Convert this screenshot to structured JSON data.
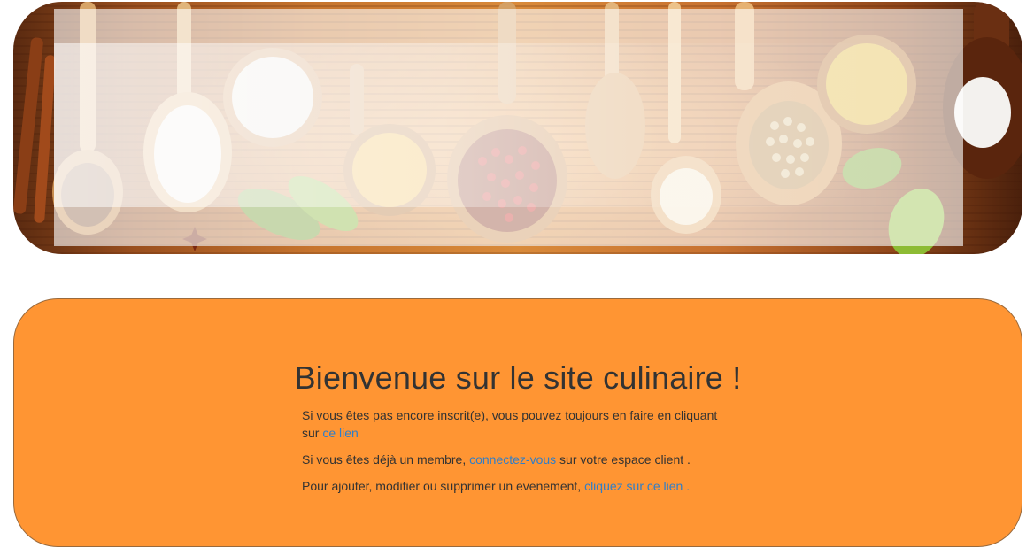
{
  "banner": {
    "image_description_icon": "spices-wooden-spoons-image"
  },
  "welcome": {
    "title": "Bienvenue sur le site culinaire !",
    "paragraph1": {
      "text_before": "Si vous êtes pas encore inscrit(e), vous pouvez toujours en faire en cliquant sur ",
      "link": "ce lien"
    },
    "paragraph2": {
      "text_before": "Si vous êtes déjà un membre, ",
      "link": "connectez-vous",
      "text_after": " sur votre espace client ."
    },
    "paragraph3": {
      "text_before": "Pour ajouter, modifier ou supprimer un evenement, ",
      "link": "cliquez sur ce lien ."
    }
  },
  "colors": {
    "panel_background": "#ff9533",
    "link": "#2f7ec9",
    "text": "#333333"
  }
}
